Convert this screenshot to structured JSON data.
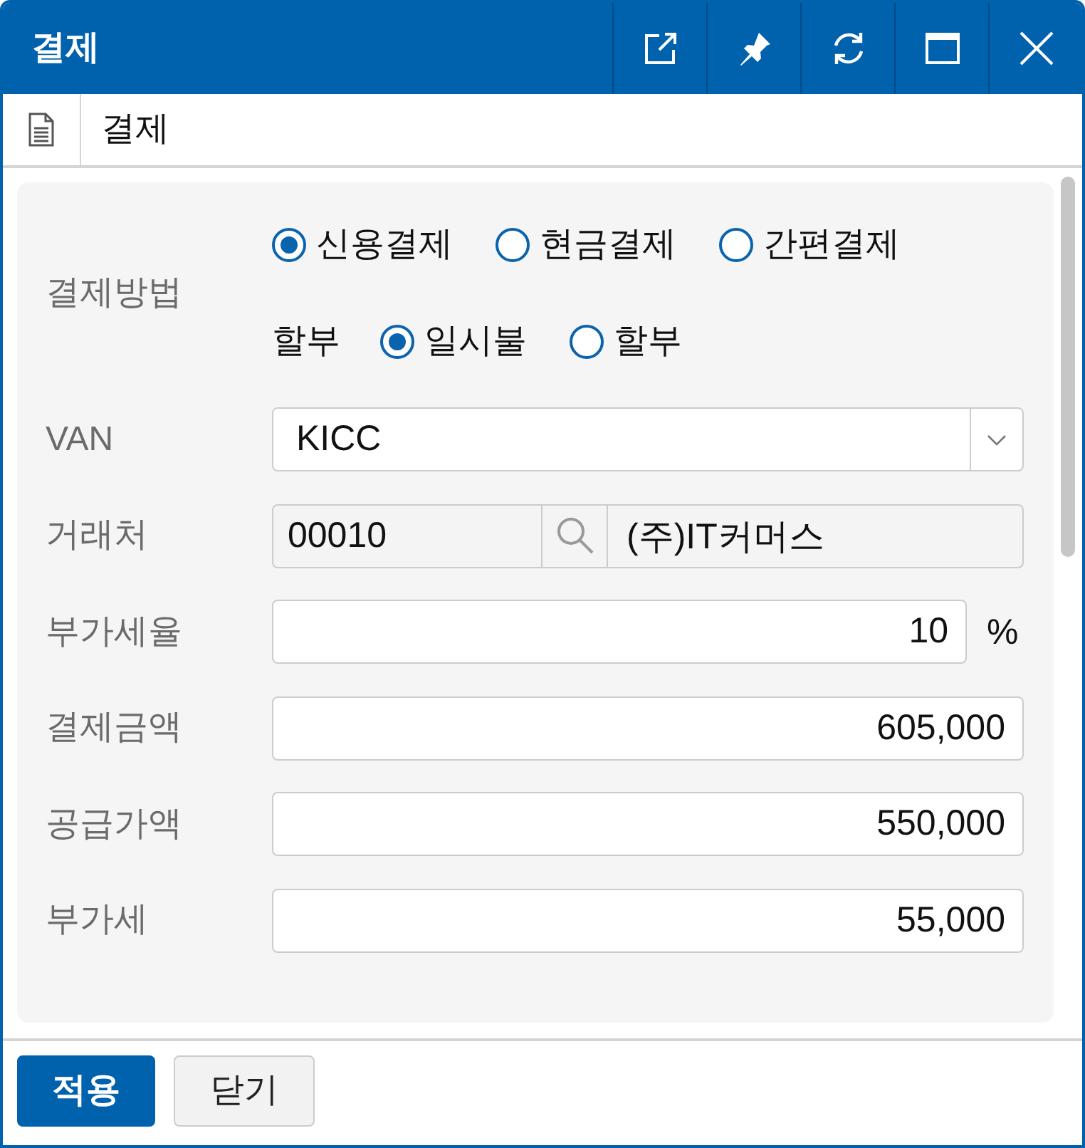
{
  "window": {
    "title": "결제"
  },
  "header": {
    "title": "결제"
  },
  "rows": [
    {
      "kind": "radio",
      "label": "결제방법",
      "options": [
        {
          "label": "신용결제",
          "selected": true
        },
        {
          "label": "현금결제",
          "selected": false
        },
        {
          "label": "간편결제",
          "selected": false
        }
      ],
      "sub": {
        "label": "할부",
        "options": [
          {
            "label": "일시불",
            "selected": true
          },
          {
            "label": "할부",
            "selected": false
          }
        ]
      }
    },
    {
      "kind": "select",
      "label": "VAN",
      "value": "KICC"
    },
    {
      "kind": "lookup",
      "label": "거래처",
      "code": "00010",
      "name": "(주)IT커머스"
    },
    {
      "kind": "number",
      "label": "부가세율",
      "value": "10",
      "unit": "%"
    },
    {
      "kind": "number",
      "label": "결제금액",
      "value": "605,000"
    },
    {
      "kind": "number",
      "label": "공급가액",
      "value": "550,000"
    },
    {
      "kind": "number",
      "label": "부가세",
      "value": "55,000"
    }
  ],
  "buttons": [
    {
      "label": "적용",
      "kind": "primary"
    },
    {
      "label": "닫기",
      "kind": "secondary"
    }
  ]
}
